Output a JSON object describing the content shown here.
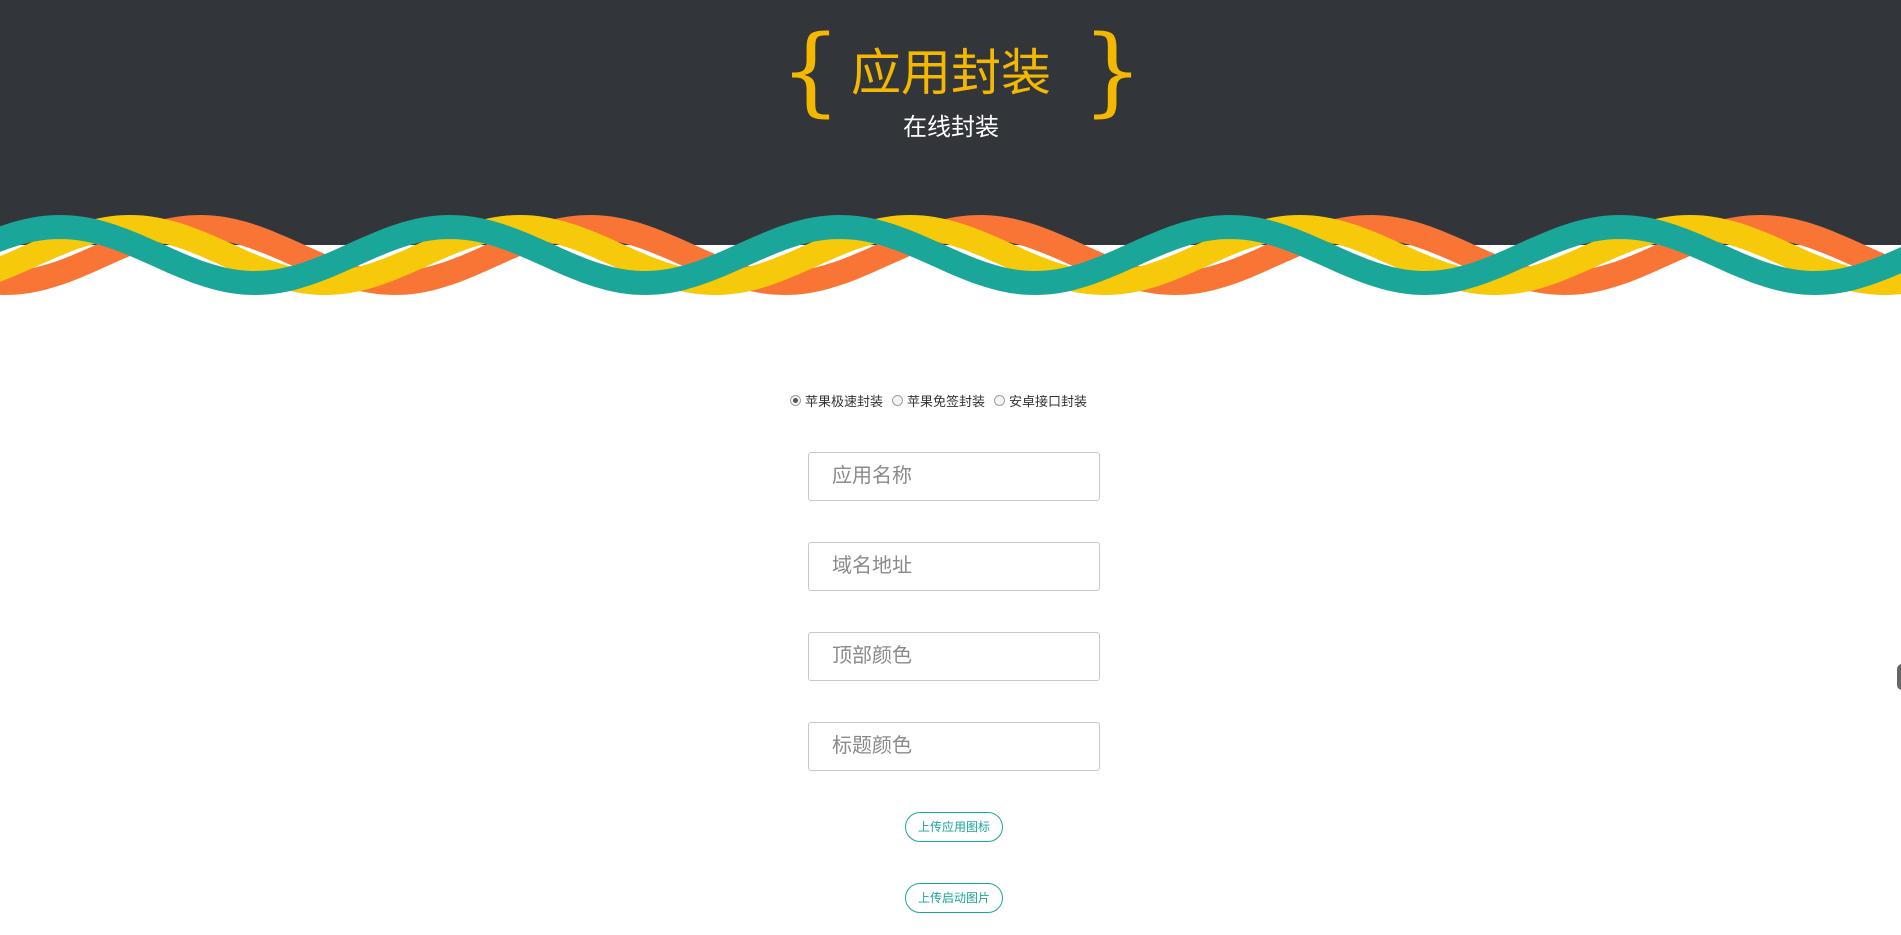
{
  "header": {
    "brace_left": "{",
    "brace_right": "}",
    "title": "应用封装",
    "subtitle": "在线封装",
    "colors": {
      "background": "#32363a",
      "title": "#f5b800",
      "subtitle": "#ffffff"
    }
  },
  "waves": {
    "colors": [
      "#f97535",
      "#f7c90b",
      "#1aa699"
    ]
  },
  "form": {
    "package_types": [
      {
        "label": "苹果极速封装",
        "checked": true
      },
      {
        "label": "苹果免签封装",
        "checked": false
      },
      {
        "label": "安卓接口封装",
        "checked": false
      }
    ],
    "fields": {
      "app_name": {
        "placeholder": "应用名称",
        "value": ""
      },
      "domain": {
        "placeholder": "域名地址",
        "value": ""
      },
      "top_color": {
        "placeholder": "顶部颜色",
        "value": ""
      },
      "title_color": {
        "placeholder": "标题颜色",
        "value": ""
      }
    },
    "buttons": {
      "upload_icon": "上传应用图标",
      "upload_splash": "上传启动图片"
    },
    "accent_color": "#1aa699"
  }
}
